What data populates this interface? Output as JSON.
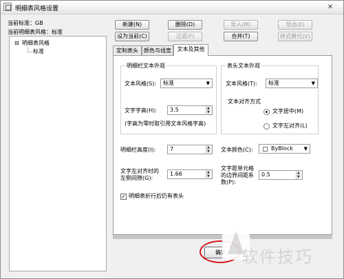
{
  "window": {
    "title": "明细表风格设置",
    "close_glyph": "✕"
  },
  "info": {
    "current_standard": "当前标准：GB",
    "current_style": "当前明细表风格：标准"
  },
  "tree": {
    "expander": "⊟",
    "root": "明细表风格",
    "child": "标准"
  },
  "buttons": {
    "new": "新建(N)",
    "delete": "删除(D)",
    "import": "导入(M)",
    "export": "导出(E)",
    "set_current": "设为当前(C)",
    "filter": "过滤(F)",
    "merge": "合并(T)",
    "style_replace": "样式替代(V)",
    "ok": "确定"
  },
  "tabs": [
    "定制表头",
    "颜色与线宽",
    "文本及其他"
  ],
  "detail_text": {
    "group_title": "明细栏文本外观",
    "style_label": "文本风格(S):",
    "style_value": "标准",
    "height_label": "文字字高(H):",
    "height_value": "3.5",
    "height_note": "(字高为零时取引用文本风格字高)"
  },
  "header_text": {
    "group_title": "表头文本外观",
    "style_label": "文本风格(T):",
    "style_value": "标准",
    "align_title": "文本对齐方式",
    "align_center": "文字居中(M)",
    "align_left": "文字左对齐(L)"
  },
  "row_height": {
    "label": "明细栏高度(I):",
    "value": "7"
  },
  "text_color": {
    "label": "文本颜色(C):",
    "value": "ByBlock"
  },
  "left_gap": {
    "label_line1": "文字左对齐时的",
    "label_line2": "左侧间隙(G):",
    "value": "1.66"
  },
  "border_gap": {
    "label_line1": "文字距单元格",
    "label_line2": "的边界间距系",
    "label_line3": "数(P):",
    "value": "0.5"
  },
  "repeat_header": {
    "label": "明细表折行后仍有表头",
    "checked": true,
    "check_glyph": "✓"
  },
  "watermark": {
    "text": "软件技巧"
  },
  "glyphs": {
    "dropdown": "▼",
    "spin_up": "▲",
    "spin_down": "▼"
  }
}
